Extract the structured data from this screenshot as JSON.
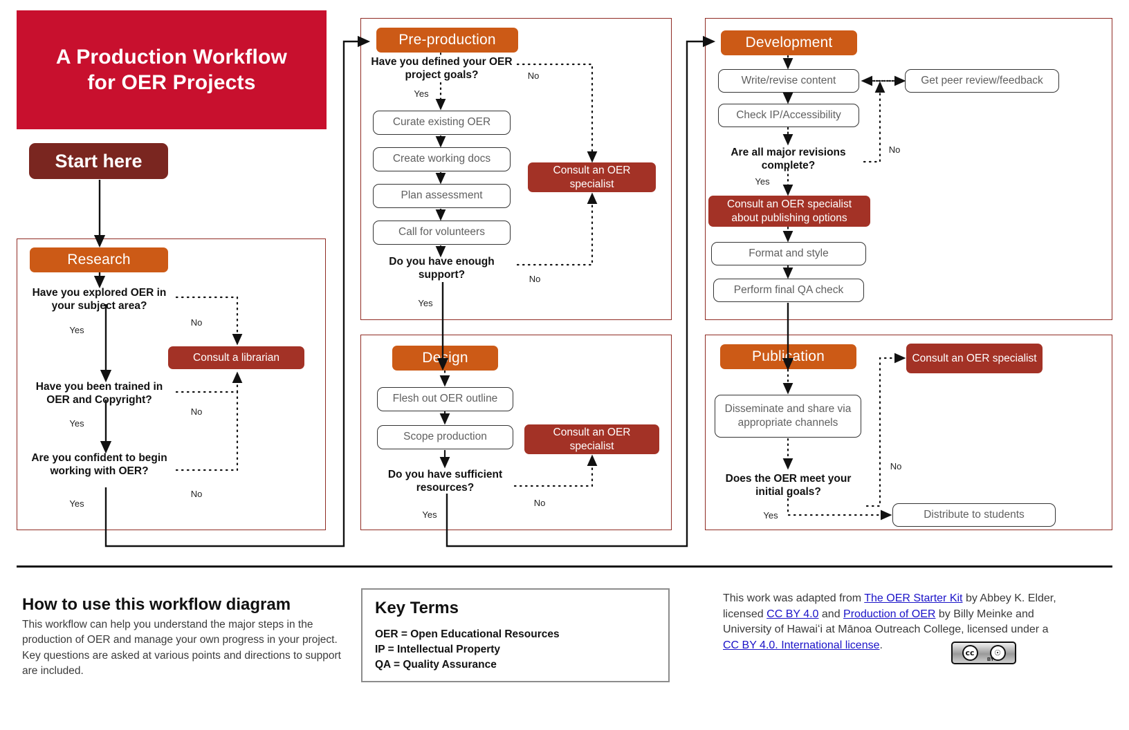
{
  "title": {
    "line1": "A Production Workflow",
    "line2": "for OER Projects"
  },
  "start": {
    "label": "Start here"
  },
  "labels": {
    "yes": "Yes",
    "no": "No"
  },
  "colors": {
    "banner_red": "#c8102e",
    "start_maroon": "#7a2620",
    "phase_orange": "#cc5a16",
    "action_dark_red": "#a33226",
    "phase_border": "#8f2a22",
    "step_text_gray": "#606060",
    "link_blue": "#1a12c8"
  },
  "phases": [
    {
      "id": "research",
      "header": "Research",
      "questions": [
        "Have you explored OER in your subject area?",
        "Have you been trained in OER and Copyright?",
        "Are you confident to begin working with OER?"
      ],
      "steps": [],
      "actions": [
        "Consult a librarian"
      ],
      "branch_labels": [
        "Yes",
        "No",
        "Yes",
        "No",
        "Yes",
        "No"
      ]
    },
    {
      "id": "pre-production",
      "header": "Pre-production",
      "questions": [
        "Have you defined your OER project goals?",
        "Do you have enough support?"
      ],
      "steps": [
        "Curate existing OER",
        "Create working docs",
        "Plan assessment",
        "Call for volunteers"
      ],
      "actions": [
        "Consult an OER specialist"
      ],
      "branch_labels": [
        "Yes",
        "No",
        "Yes",
        "No"
      ]
    },
    {
      "id": "design",
      "header": "Design",
      "questions": [
        "Do you have sufficient resources?"
      ],
      "steps": [
        "Flesh out OER outline",
        "Scope production"
      ],
      "actions": [
        "Consult an OER specialist"
      ],
      "branch_labels": [
        "Yes",
        "No"
      ]
    },
    {
      "id": "development",
      "header": "Development",
      "questions": [
        "Are all major revisions complete?"
      ],
      "steps": [
        "Write/revise content",
        "Get peer review/feedback",
        "Check IP/Accessibility",
        "Format and style",
        "Perform final QA check"
      ],
      "actions": [
        "Consult an OER specialist about publishing options"
      ],
      "branch_labels": [
        "Yes",
        "No"
      ]
    },
    {
      "id": "publication",
      "header": "Publication",
      "questions": [
        "Does the OER meet your initial goals?"
      ],
      "steps": [
        "Disseminate and share via appropriate channels",
        "Distribute to students"
      ],
      "actions": [
        "Consult an OER specialist"
      ],
      "branch_labels": [
        "Yes",
        "No"
      ]
    }
  ],
  "research": {
    "header": "Research",
    "q1": "Have you explored OER in your subject area?",
    "q2": "Have you been trained in OER and Copyright?",
    "q3": "Are you confident to begin working with OER?",
    "action": "Consult a librarian",
    "yes1": "Yes",
    "no1": "No",
    "yes2": "Yes",
    "no2": "No",
    "yes3": "Yes",
    "no3": "No"
  },
  "preproduction": {
    "header": "Pre-production",
    "q1": "Have you defined your OER project goals?",
    "q2": "Do you have enough support?",
    "step1": "Curate existing OER",
    "step2": "Create working docs",
    "step3": "Plan assessment",
    "step4": "Call for volunteers",
    "action": "Consult an OER specialist",
    "yes1": "Yes",
    "no1": "No",
    "yes2": "Yes",
    "no2": "No"
  },
  "design": {
    "header": "Design",
    "step1": "Flesh out OER outline",
    "step2": "Scope production",
    "q1": "Do you have sufficient resources?",
    "action": "Consult an OER specialist",
    "yes1": "Yes",
    "no1": "No"
  },
  "development": {
    "header": "Development",
    "step1": "Write/revise content",
    "peer": "Get peer review/feedback",
    "step2": "Check IP/Accessibility",
    "q1": "Are all major revisions complete?",
    "action": "Consult an OER specialist about publishing options",
    "step3": "Format and style",
    "step4": "Perform final QA check",
    "yes1": "Yes",
    "no1": "No"
  },
  "publication": {
    "header": "Publication",
    "action": "Consult an OER specialist",
    "step1": "Disseminate and share via appropriate channels",
    "q1": "Does the OER meet your initial goals?",
    "distribute": "Distribute to students",
    "yes1": "Yes",
    "no1": "No"
  },
  "howto": {
    "heading": "How to use this workflow diagram",
    "body": "This workflow can help you understand the major steps in the production of OER and manage your own progress in your project. Key questions are asked at various points and directions to support are included."
  },
  "key_terms": {
    "heading": "Key Terms",
    "line1": "OER = Open Educational Resources",
    "line2": "IP = Intellectual Property",
    "line3": "QA = Quality Assurance"
  },
  "attribution": {
    "p1": "This work was adapted from ",
    "link1": "The OER Starter Kit",
    "p2": " by Abbey K. Elder, licensed ",
    "link2": "CC BY 4.0",
    "p3": " and ",
    "link3": "Production of OER",
    "p4": " by Billy Meinke and University of Hawaiʻi at Mānoa Outreach College, licensed under a ",
    "link4": "CC BY 4.0. International license",
    "p5": ".",
    "badge_cc": "cc",
    "badge_by": "i",
    "badge_sub": "BY"
  }
}
